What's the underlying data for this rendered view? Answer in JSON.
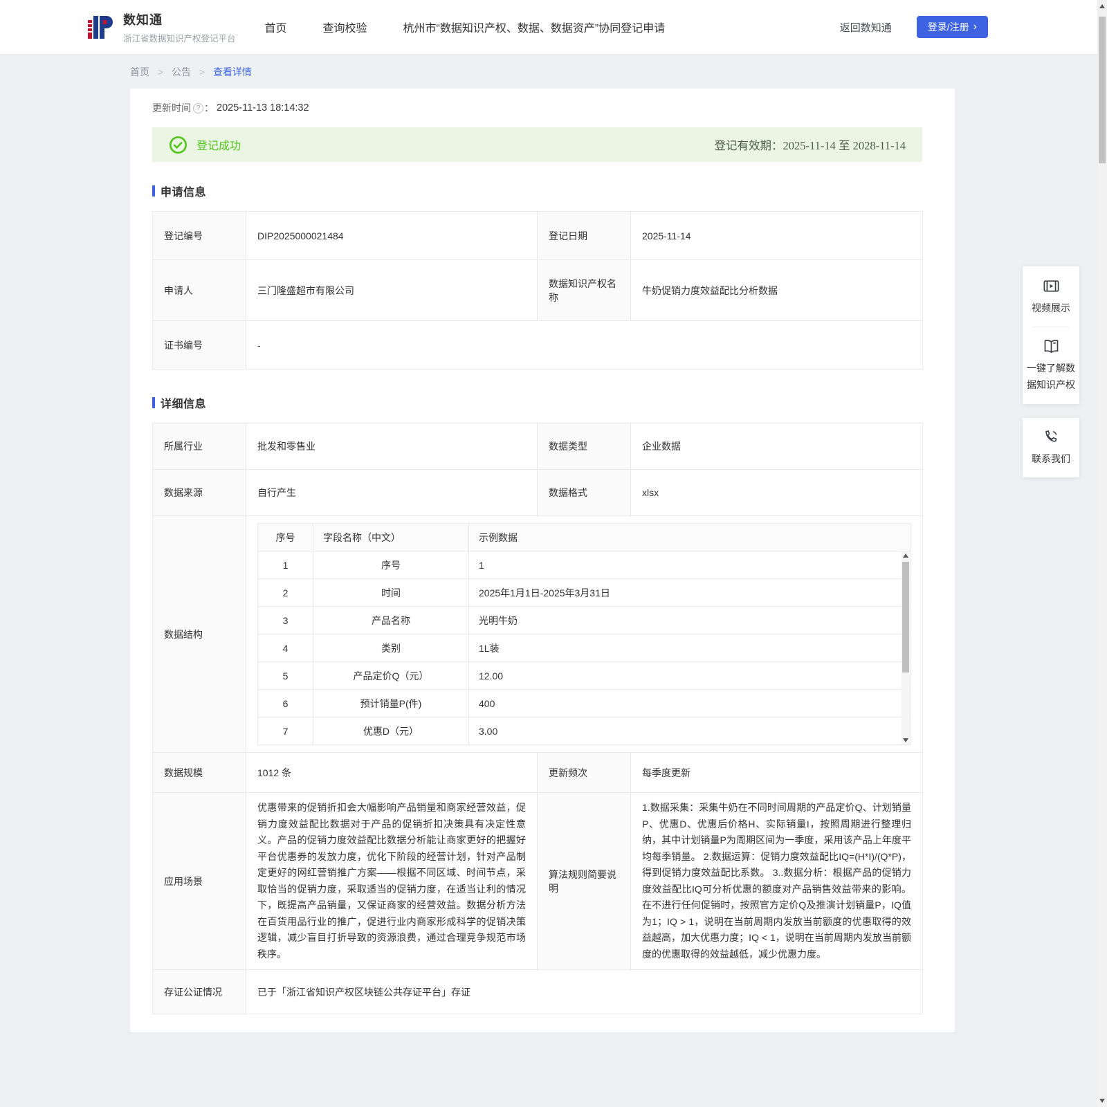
{
  "colors": {
    "accent": "#3d63e2",
    "success": "#52c41a",
    "success_bg": "#ebf5e3"
  },
  "header": {
    "logo_title": "数知通",
    "logo_subtitle": "浙江省数据知识产权登记平台",
    "nav": [
      {
        "label": "首页"
      },
      {
        "label": "查询校验"
      },
      {
        "label": "杭州市“数据知识产权、数据、数据资产”协同登记申请"
      }
    ],
    "back_link": "返回数知通",
    "login_button": "登录/注册"
  },
  "breadcrumb": {
    "separator": ">",
    "items": [
      "首页",
      "公告",
      "查看详情"
    ]
  },
  "meta": {
    "update_time_label": "更新时间",
    "colon": "：",
    "update_time_value": "2025-11-13 18:14:32"
  },
  "banner": {
    "status": "登记成功",
    "validity_label": "登记有效期：",
    "validity_value": "2025-11-14 至 2028-11-14"
  },
  "application": {
    "title": "申请信息",
    "reg_no_label": "登记编号",
    "reg_no": "DIP2025000021484",
    "reg_date_label": "登记日期",
    "reg_date": "2025-11-14",
    "applicant_label": "申请人",
    "applicant": "三门隆盛超市有限公司",
    "ip_name_label": "数据知识产权名称",
    "ip_name": "牛奶促销力度效益配比分析数据",
    "cert_no_label": "证书编号",
    "cert_no": "-"
  },
  "detail": {
    "title": "详细信息",
    "industry_label": "所属行业",
    "industry": "批发和零售业",
    "data_type_label": "数据类型",
    "data_type": "企业数据",
    "source_label": "数据来源",
    "source": "自行产生",
    "format_label": "数据格式",
    "format": "xlsx",
    "structure_label": "数据结构",
    "structure_table": {
      "headers": [
        "序号",
        "字段名称（中文）",
        "示例数据"
      ],
      "rows": [
        [
          "1",
          "序号",
          "1"
        ],
        [
          "2",
          "时间",
          "2025年1月1日-2025年3月31日"
        ],
        [
          "3",
          "产品名称",
          "光明牛奶"
        ],
        [
          "4",
          "类别",
          "1L装"
        ],
        [
          "5",
          "产品定价Q（元）",
          "12.00"
        ],
        [
          "6",
          "预计销量P(件)",
          "400"
        ],
        [
          "7",
          "优惠D（元）",
          "3.00"
        ]
      ]
    },
    "scale_label": "数据规模",
    "scale": "1012 条",
    "frequency_label": "更新频次",
    "frequency": "每季度更新",
    "scenario_label": "应用场景",
    "scenario": "优惠带来的促销折扣会大幅影响产品销量和商家经营效益，促销力度效益配比数据对于产品的促销折扣决策具有决定性意义。产品的促销力度效益配比数据分析能让商家更好的把握好平台优惠券的发放力度，优化下阶段的经营计划，针对产品制定更好的网红营销推广方案——根据不同区域、时间节点，采取恰当的促销力度，采取适当的促销力度，在适当让利的情况下，既提高产品销量，又保证商家的经营效益。数据分析方法在百货用品行业的推广，促进行业内商家形成科学的促销决策逻辑，减少盲目打折导致的资源浪费，通过合理竞争规范市场秩序。",
    "algorithm_label": "算法规则简要说明",
    "algorithm": "1.数据采集：采集牛奶在不同时间周期的产品定价Q、计划销量P、优惠D、优惠后价格H、实际销量I，按照周期进行整理归纳，其中计划销量P为周期区间为一季度，采用该产品上年度平均每季销量。 2.数据运算：促销力度效益配比IQ=(H*I)/(Q*P)，得到促销力度效益配比系数。 3..数据分析：根据产品的促销力度效益配比IQ可分析优惠的额度对产品销售效益带来的影响。在不进行任何促销时，按照官方定价Q及推演计划销量P，IQ值为1；IQ > 1，说明在当前周期内发放当前额度的优惠取得的效益越高，加大优惠力度；IQ < 1，说明在当前周期内发放当前额度的优惠取得的效益越低，减少优惠力度。",
    "notary_label": "存证公证情况",
    "notary": "已于「浙江省知识产权区块链公共存证平台」存证"
  },
  "floating_panel": {
    "video_label": "视频展示",
    "guide_label": "一键了解数据知识产权",
    "contact_label": "联系我们"
  },
  "icons": {
    "logo": "ip-logo",
    "help": "question-circle-icon",
    "success": "check-circle-icon",
    "video": "video-icon",
    "guide": "book-icon",
    "contact": "phone-icon",
    "help_glyph": "?",
    "chevron_glyph": "›"
  }
}
